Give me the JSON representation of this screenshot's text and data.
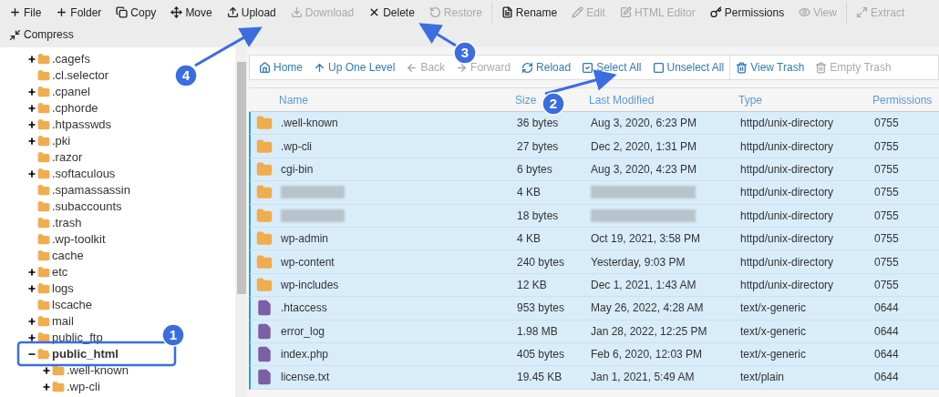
{
  "toolbar": [
    {
      "label": "File",
      "disabled": false
    },
    {
      "label": "Folder",
      "disabled": false
    },
    {
      "label": "Copy",
      "disabled": false
    },
    {
      "label": "Move",
      "disabled": false
    },
    {
      "label": "Upload",
      "disabled": false
    },
    {
      "label": "Download",
      "disabled": true
    },
    {
      "label": "Delete",
      "disabled": false
    },
    {
      "label": "Restore",
      "disabled": true,
      "divider_after": true
    },
    {
      "label": "Rename",
      "disabled": false
    },
    {
      "label": "Edit",
      "disabled": true
    },
    {
      "label": "HTML Editor",
      "disabled": true
    },
    {
      "label": "Permissions",
      "disabled": false
    },
    {
      "label": "View",
      "disabled": true,
      "divider_after": true
    },
    {
      "label": "Extract",
      "disabled": true
    },
    {
      "label": "Compress",
      "disabled": false
    }
  ],
  "tree": [
    {
      "label": ".cagefs",
      "kind": "collapsed",
      "selected": false
    },
    {
      "label": ".cl.selector",
      "kind": "leaf",
      "selected": false
    },
    {
      "label": ".cpanel",
      "kind": "collapsed",
      "selected": false
    },
    {
      "label": ".cphorde",
      "kind": "collapsed",
      "selected": false
    },
    {
      "label": ".htpasswds",
      "kind": "collapsed",
      "selected": false
    },
    {
      "label": ".pki",
      "kind": "collapsed",
      "selected": false
    },
    {
      "label": ".razor",
      "kind": "leaf",
      "selected": false
    },
    {
      "label": ".softaculous",
      "kind": "collapsed",
      "selected": false
    },
    {
      "label": ".spamassassin",
      "kind": "leaf",
      "selected": false
    },
    {
      "label": ".subaccounts",
      "kind": "leaf",
      "selected": false
    },
    {
      "label": ".trash",
      "kind": "leaf",
      "selected": false
    },
    {
      "label": ".wp-toolkit",
      "kind": "leaf",
      "selected": false
    },
    {
      "label": "cache",
      "kind": "leaf",
      "selected": false
    },
    {
      "label": "etc",
      "kind": "collapsed",
      "selected": false
    },
    {
      "label": "logs",
      "kind": "collapsed",
      "selected": false
    },
    {
      "label": "lscache",
      "kind": "leaf",
      "selected": false
    },
    {
      "label": "mail",
      "kind": "collapsed",
      "selected": false
    },
    {
      "label": "public_ftp",
      "kind": "collapsed",
      "selected": false
    },
    {
      "label": "public_html",
      "kind": "expanded",
      "selected": true,
      "children": [
        {
          "label": ".well-known",
          "kind": "collapsed",
          "selected": false
        },
        {
          "label": ".wp-cli",
          "kind": "collapsed",
          "selected": false
        }
      ]
    }
  ],
  "nav": [
    {
      "label": "Home",
      "disabled": false
    },
    {
      "label": "Up One Level",
      "disabled": false
    },
    {
      "label": "Back",
      "disabled": true
    },
    {
      "label": "Forward",
      "disabled": true
    },
    {
      "label": "Reload",
      "disabled": false
    },
    {
      "label": "Select All",
      "disabled": false
    },
    {
      "label": "Unselect All",
      "disabled": false,
      "divider_after": true
    },
    {
      "label": "View Trash",
      "disabled": false
    },
    {
      "label": "Empty Trash",
      "disabled": true
    }
  ],
  "table": {
    "columns": [
      "Name",
      "Size",
      "Last Modified",
      "Type",
      "Permissions"
    ],
    "rows": [
      {
        "kind": "folder",
        "selected": true,
        "blurred": false,
        "name": ".well-known",
        "size": "36 bytes",
        "modified": "Aug 3, 2020, 6:23 PM",
        "type": "httpd/unix-directory",
        "permissions": "0755"
      },
      {
        "kind": "folder",
        "selected": true,
        "blurred": false,
        "name": ".wp-cli",
        "size": "27 bytes",
        "modified": "Dec 2, 2020, 1:31 PM",
        "type": "httpd/unix-directory",
        "permissions": "0755"
      },
      {
        "kind": "folder",
        "selected": true,
        "blurred": false,
        "name": "cgi-bin",
        "size": "6 bytes",
        "modified": "Aug 3, 2020, 4:23 PM",
        "type": "httpd/unix-directory",
        "permissions": "0755"
      },
      {
        "kind": "folder",
        "selected": true,
        "blurred": true,
        "size": "4 KB",
        "type": "httpd/unix-directory",
        "permissions": "0755"
      },
      {
        "kind": "folder",
        "selected": true,
        "blurred": true,
        "size": "18 bytes",
        "type": "httpd/unix-directory",
        "permissions": "0755"
      },
      {
        "kind": "folder",
        "selected": true,
        "blurred": false,
        "name": "wp-admin",
        "size": "4 KB",
        "modified": "Oct 19, 2021, 3:58 PM",
        "type": "httpd/unix-directory",
        "permissions": "0755"
      },
      {
        "kind": "folder",
        "selected": true,
        "blurred": false,
        "name": "wp-content",
        "size": "240 bytes",
        "modified": "Yesterday, 9:03 PM",
        "type": "httpd/unix-directory",
        "permissions": "0755"
      },
      {
        "kind": "folder",
        "selected": true,
        "blurred": false,
        "name": "wp-includes",
        "size": "12 KB",
        "modified": "Dec 1, 2021, 1:43 AM",
        "type": "httpd/unix-directory",
        "permissions": "0755"
      },
      {
        "kind": "file",
        "selected": true,
        "blurred": false,
        "name": ".htaccess",
        "size": "953 bytes",
        "modified": "May 26, 2022, 4:28 AM",
        "type": "text/x-generic",
        "permissions": "0644"
      },
      {
        "kind": "file",
        "selected": true,
        "blurred": false,
        "name": "error_log",
        "size": "1.98 MB",
        "modified": "Jan 28, 2022, 12:25 PM",
        "type": "text/x-generic",
        "permissions": "0644"
      },
      {
        "kind": "file",
        "selected": true,
        "blurred": false,
        "name": "index.php",
        "size": "405 bytes",
        "modified": "Feb 6, 2020, 12:03 PM",
        "type": "text/x-generic",
        "permissions": "0644"
      },
      {
        "kind": "file",
        "selected": true,
        "blurred": false,
        "name": "license.txt",
        "size": "19.45 KB",
        "modified": "Jan 1, 2021, 5:49 AM",
        "type": "text/plain",
        "permissions": "0644"
      }
    ]
  },
  "annotations": [
    {
      "number": "1",
      "kind": "box"
    },
    {
      "number": "2",
      "kind": "arrow"
    },
    {
      "number": "3",
      "kind": "arrow"
    },
    {
      "number": "4",
      "kind": "arrow"
    }
  ]
}
